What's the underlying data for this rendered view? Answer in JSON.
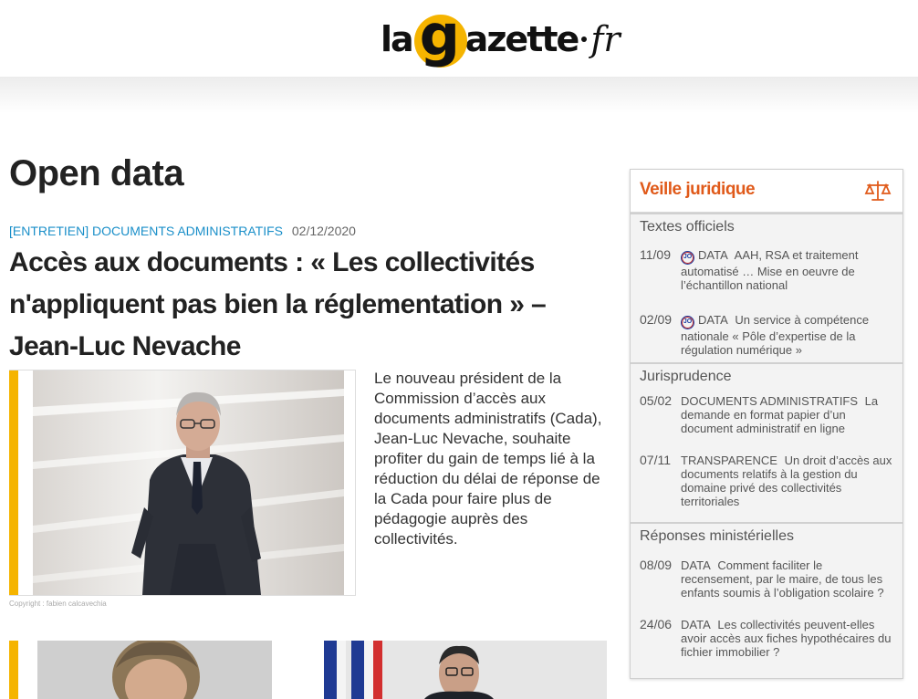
{
  "header": {
    "logo": {
      "part1": "la",
      "g": "g",
      "part2": "azette",
      "part3": "fr",
      "brand_color": "#f5b400"
    }
  },
  "main": {
    "page_title": "Open data",
    "article": {
      "category": "[ENTRETIEN] DOCUMENTS ADMINISTRATIFS",
      "date": "02/12/2020",
      "title": "Accès aux documents : « Les collectivités n'appliquent pas bien la réglementation » – Jean-Luc Nevache",
      "lead": "Le nouveau président de la Commission d’accès aux documents administratifs (Cada), Jean-Luc Nevache, souhaite profiter du gain de temps lié à la réduction du délai de réponse de la Cada pour faire plus de pédagogie auprès des collectivités.",
      "copyright": "Copyright : fabien calcavechia"
    }
  },
  "sidebar": {
    "title": "Veille juridique",
    "accent": "#e05a1a",
    "sections": [
      {
        "title": "Textes officiels",
        "items": [
          {
            "date": "11/09",
            "badge": "JO",
            "tag": "DATA",
            "text": "AAH, RSA et traitement automatisé … Mise en oeuvre de l’échantillon national"
          },
          {
            "date": "02/09",
            "badge": "JO",
            "tag": "DATA",
            "text": "Un service à compétence nationale « Pôle d’expertise de la régulation numérique »"
          }
        ]
      },
      {
        "title": "Jurisprudence",
        "items": [
          {
            "date": "05/02",
            "tag": "DOCUMENTS ADMINISTRATIFS",
            "text": "La demande en format papier d’un document administratif en ligne"
          },
          {
            "date": "07/11",
            "tag": "TRANSPARENCE",
            "text": "Un droit d’accès aux documents relatifs à la gestion du domaine privé des collectivités territoriales"
          }
        ]
      },
      {
        "title": "Réponses ministérielles",
        "items": [
          {
            "date": "08/09",
            "tag": "DATA",
            "text": "Comment faciliter le recensement, par le maire, de tous les enfants soumis à l’obligation scolaire ?"
          },
          {
            "date": "24/06",
            "tag": "DATA",
            "text": "Les collectivités peuvent-elles avoir accès aux fiches hypothécaires du fichier immobilier ?"
          }
        ]
      }
    ]
  }
}
